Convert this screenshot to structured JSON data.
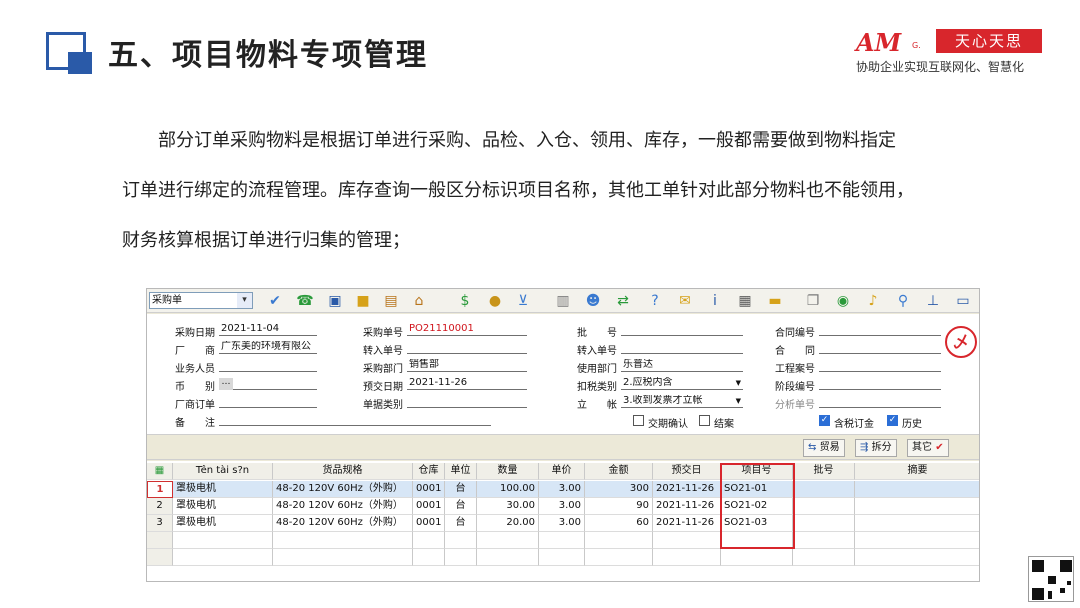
{
  "slide": {
    "title": "五、项目物料专项管理",
    "brand_am": "AM",
    "brand_am_sub": "G.",
    "brand_name": "天心天思",
    "brand_slogan": "协助企业实现互联网化、智慧化",
    "paragraph": [
      "　　部分订单采购物料是根据订单进行采购、品检、入仓、领用、库存，一般都需要做到物料指定",
      "订单进行绑定的流程管理。库存查询一般区分标识项目名称，其他工单针对此部分物料也不能领用，",
      "财务核算根据订单进行归集的管理；"
    ]
  },
  "app": {
    "doc_type": "采购单",
    "form": {
      "purchase_date_label": "采购日期",
      "purchase_date": "2021-11-04",
      "vendor_label": "厂　　商",
      "vendor": "广东美的环境有限公",
      "salesperson_label": "业务人员",
      "salesperson": "",
      "currency_label": "币　　别",
      "currency": "",
      "vendor_order_label": "厂商订单",
      "vendor_order": "",
      "remark_label": "备　　注",
      "remark": "",
      "po_no_label": "采购单号",
      "po_no": "PO21110001",
      "transfer_in_no_label": "转入单号",
      "transfer_in_no": "",
      "dept_label": "采购部门",
      "dept": "销售部",
      "delivery_date_label": "预交日期",
      "delivery_date": "2021-11-26",
      "doc_category_label": "单据类别",
      "doc_category": "",
      "batch_label": "批　　号",
      "batch": "",
      "transfer_in_no2_label": "转入单号",
      "transfer_in_no2": "",
      "use_dept_label": "使用部门",
      "use_dept": "乐普达",
      "tax_type_label": "扣税类别",
      "tax_type": "2.应税内含",
      "account_label": "立　　帐",
      "account": "3.收到发票才立帐",
      "contract_no_label": "合同编号",
      "contract_no": "",
      "contract_label": "合　　同",
      "contract": "",
      "project_case_label": "工程案号",
      "project_case": "",
      "stage_no_label": "阶段编号",
      "stage_no": "",
      "analysis_no_label": "分析单号",
      "analysis_no": "",
      "trade_confirm_label": "交期确认",
      "close_label": "结案",
      "tax_order_label": "含税订金",
      "history_label": "历史",
      "stamp_text": "乄"
    },
    "buttons": {
      "trade": "贸易",
      "split": "拆分",
      "other": "其它"
    },
    "grid": {
      "headers": [
        "Tên tài s?n",
        "货品规格",
        "仓库",
        "单位",
        "数量",
        "单价",
        "金额",
        "预交日",
        "项目号",
        "批号",
        "摘要"
      ],
      "rows": [
        {
          "no": "1",
          "name": "罩极电机",
          "spec": "48-20 120V 60Hz（外购）",
          "wh": "0001",
          "unit": "台",
          "qty": "100.00",
          "price": "3.00",
          "amount": "300",
          "date": "2021-11-26",
          "project": "SO21-01",
          "batch": "",
          "memo": ""
        },
        {
          "no": "2",
          "name": "罩极电机",
          "spec": "48-20 120V 60Hz（外购）",
          "wh": "0001",
          "unit": "台",
          "qty": "30.00",
          "price": "3.00",
          "amount": "90",
          "date": "2021-11-26",
          "project": "SO21-02",
          "batch": "",
          "memo": ""
        },
        {
          "no": "3",
          "name": "罩极电机",
          "spec": "48-20 120V 60Hz（外购）",
          "wh": "0001",
          "unit": "台",
          "qty": "20.00",
          "price": "3.00",
          "amount": "60",
          "date": "2021-11-26",
          "project": "SO21-03",
          "batch": "",
          "memo": ""
        }
      ]
    }
  }
}
